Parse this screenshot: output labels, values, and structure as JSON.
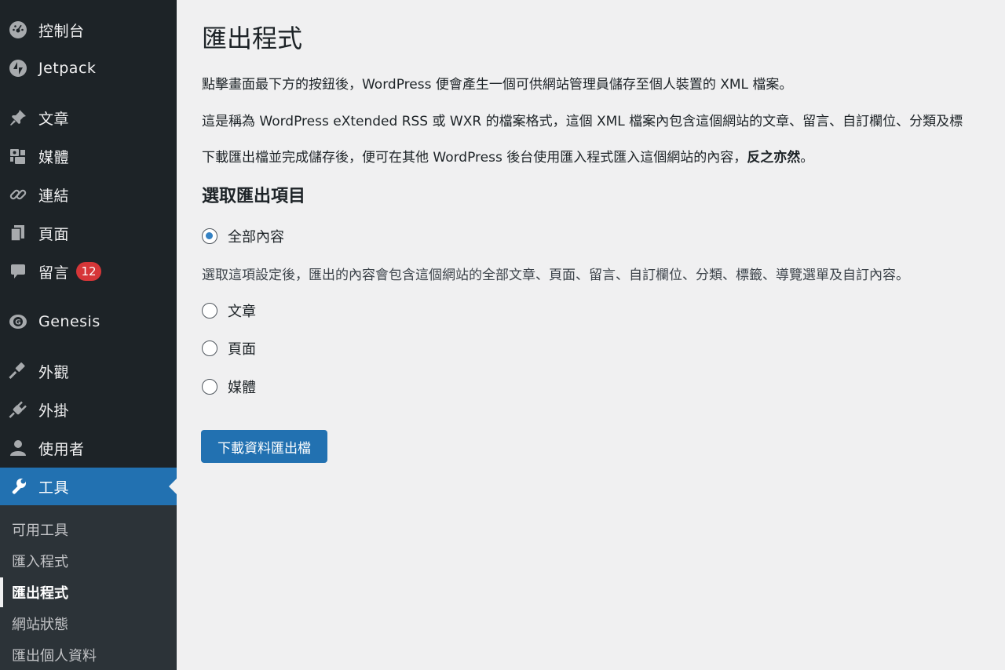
{
  "sidebar": {
    "items": [
      {
        "label": "控制台",
        "icon": "dashboard-icon"
      },
      {
        "label": "Jetpack",
        "icon": "jetpack-icon"
      },
      {
        "label": "文章",
        "icon": "pin-icon"
      },
      {
        "label": "媒體",
        "icon": "media-icon"
      },
      {
        "label": "連結",
        "icon": "link-icon"
      },
      {
        "label": "頁面",
        "icon": "pages-icon"
      },
      {
        "label": "留言",
        "icon": "comments-icon",
        "badge": "12"
      },
      {
        "label": "Genesis",
        "icon": "genesis-icon"
      },
      {
        "label": "外觀",
        "icon": "appearance-icon"
      },
      {
        "label": "外掛",
        "icon": "plugins-icon"
      },
      {
        "label": "使用者",
        "icon": "users-icon"
      },
      {
        "label": "工具",
        "icon": "tools-icon",
        "active": true
      }
    ],
    "submenu": [
      "可用工具",
      "匯入程式",
      "匯出程式",
      "網站狀態",
      "匯出個人資料"
    ],
    "current_submenu": "匯出程式"
  },
  "colors": {
    "sidebar_bg": "#1d2327",
    "submenu_bg": "#2c3338",
    "accent": "#2271b1",
    "badge": "#d63638",
    "page_bg": "#f0f0f1"
  },
  "main": {
    "title": "匯出程式",
    "para1": "點擊畫面最下方的按鈕後，WordPress 便會產生一個可供網站管理員儲存至個人裝置的 XML 檔案。",
    "para2": "這是稱為 WordPress eXtended RSS 或 WXR 的檔案格式，這個 XML 檔案內包含這個網站的文章、留言、自訂欄位、分類及標",
    "para3": "下載匯出檔並完成儲存後，便可在其他 WordPress 後台使用匯入程式匯入這個網站的內容，",
    "para3_bold": "反之亦然",
    "para3_end": "。",
    "section_title": "選取匯出項目",
    "options": [
      {
        "label": "全部內容",
        "checked": true
      },
      {
        "label": "文章",
        "checked": false
      },
      {
        "label": "頁面",
        "checked": false
      },
      {
        "label": "媒體",
        "checked": false
      }
    ],
    "all_content_desc": "選取這項設定後，匯出的內容會包含這個網站的全部文章、頁面、留言、自訂欄位、分類、標籤、導覽選單及自訂內容。",
    "download_button": "下載資料匯出檔"
  }
}
